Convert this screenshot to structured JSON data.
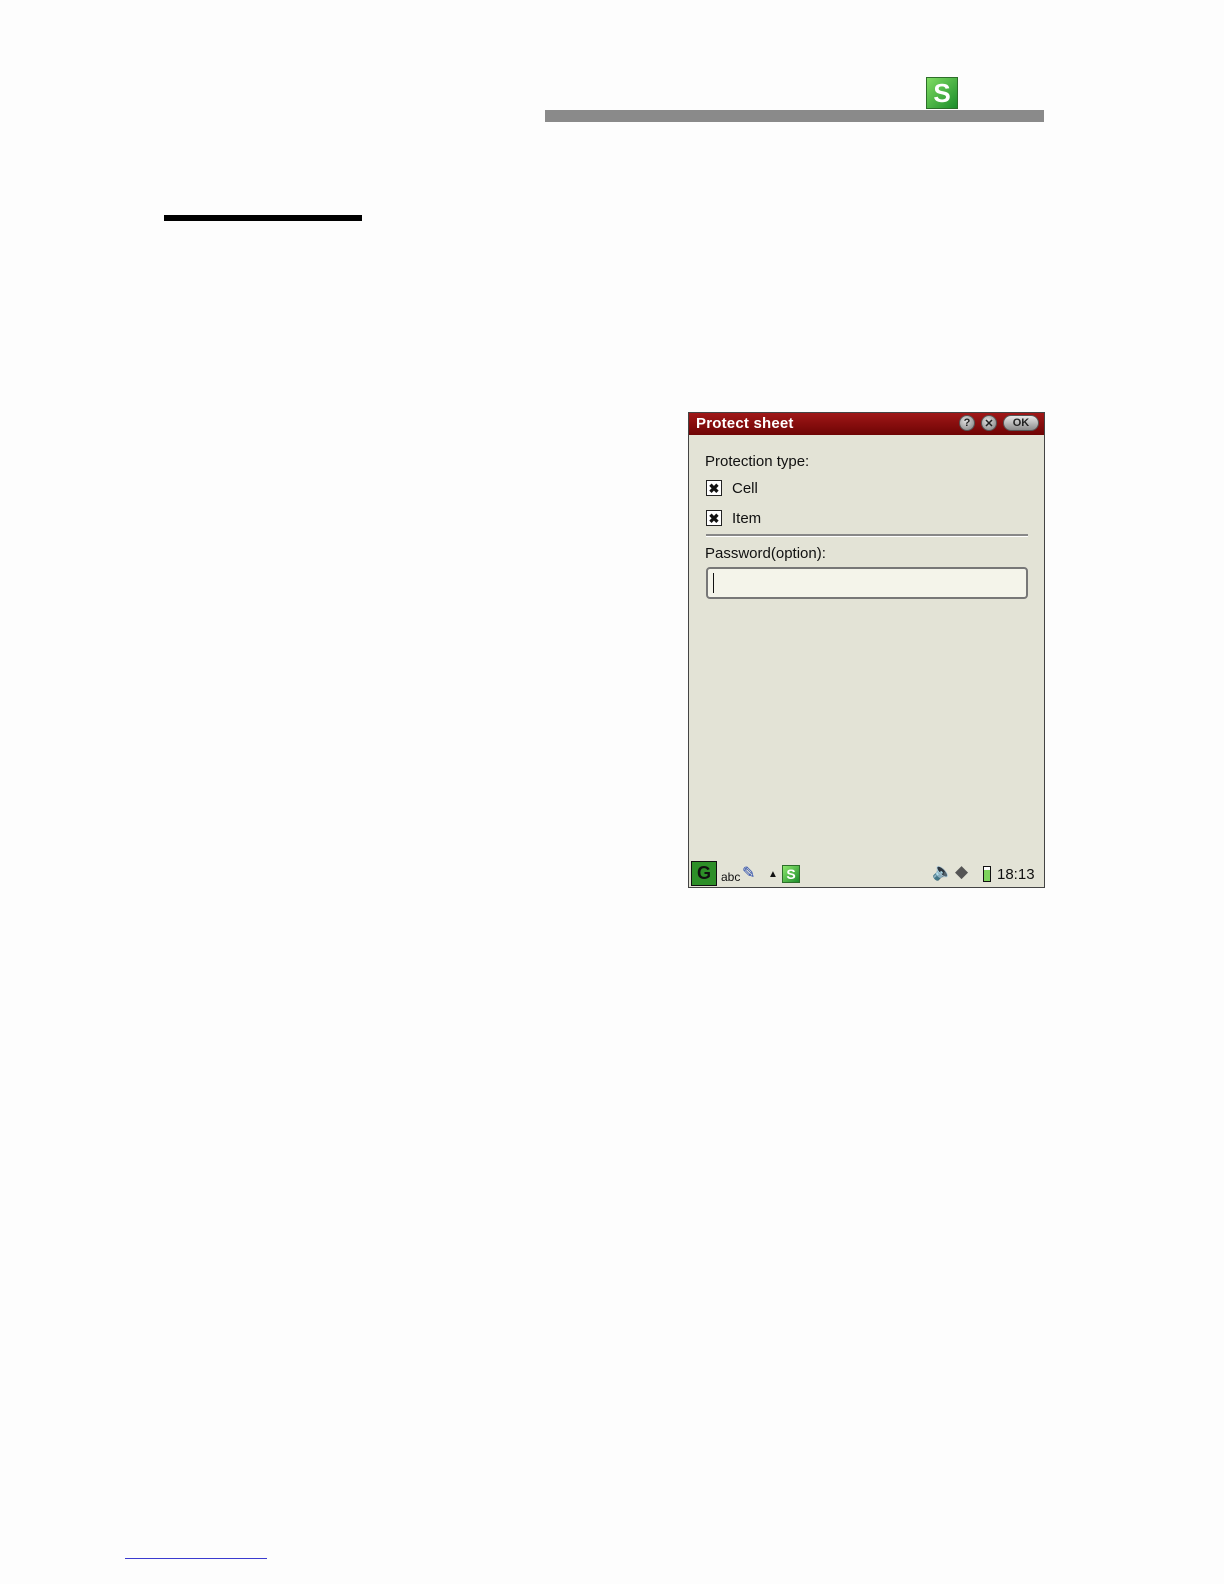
{
  "page": {
    "header_icon": "spreadsheet-app-icon"
  },
  "dialog": {
    "title": "Protect sheet",
    "help_label": "?",
    "close_label": "✕",
    "ok_label": "OK",
    "protection_type_label": "Protection type:",
    "options": [
      {
        "label": "Cell",
        "checked": true
      },
      {
        "label": "Item",
        "checked": true
      }
    ],
    "password_label": "Password(option):",
    "password_value": ""
  },
  "statusbar": {
    "start_glyph": "G",
    "input_mode": "abc",
    "pen_glyph": "✎",
    "arrow_glyph": "▲",
    "sheet_glyph": "S",
    "speaker_glyph": "🔈",
    "pen_status_glyph": "◆",
    "clock": "18:13"
  },
  "icons": {
    "header": "spreadsheet-icon",
    "checkbox_mark": "✖"
  }
}
